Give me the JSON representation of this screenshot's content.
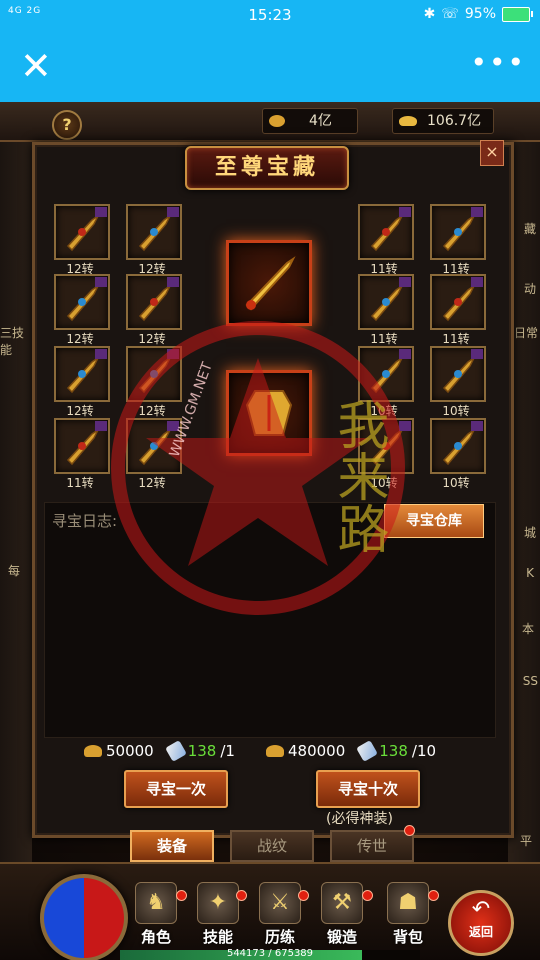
{
  "status_bar": {
    "signal": "4G 2G",
    "time": "15:23",
    "battery": "95%"
  },
  "title_bar": {
    "close_icon": "close-icon",
    "more_icon": "more-icon"
  },
  "resources": {
    "gold": "4亿",
    "ingot": "106.7亿"
  },
  "panel": {
    "title": "至尊宝藏",
    "help": "?",
    "close": "×"
  },
  "left_items": [
    {
      "label": "12转"
    },
    {
      "label": "12转"
    },
    {
      "label": "12转"
    },
    {
      "label": "12转"
    },
    {
      "label": "12转"
    },
    {
      "label": "12转"
    },
    {
      "label": "11转"
    },
    {
      "label": "12转"
    }
  ],
  "right_items": [
    {
      "label": "11转"
    },
    {
      "label": "11转"
    },
    {
      "label": "11转"
    },
    {
      "label": "11转"
    },
    {
      "label": "10转"
    },
    {
      "label": "10转"
    },
    {
      "label": "10转"
    },
    {
      "label": "10转"
    }
  ],
  "log": {
    "label": "寻宝日志:",
    "depot_button": "寻宝仓库"
  },
  "costs": {
    "once_coin": "50000",
    "once_scroll": "138",
    "once_need": "/1",
    "ten_coin": "480000",
    "ten_scroll": "138",
    "ten_need": "/10"
  },
  "buttons": {
    "once": "寻宝一次",
    "ten": "寻宝十次",
    "ten_note": "(必得神装)"
  },
  "tabs": [
    "装备",
    "战纹",
    "传世"
  ],
  "nav": [
    "角色",
    "技能",
    "历练",
    "锻造",
    "背包"
  ],
  "back": "返回",
  "exp": {
    "text": "544173 / 675389",
    "fraction": 0.806
  },
  "side_left": [
    "三技能",
    "每"
  ],
  "side_right": [
    "藏",
    "动",
    "日常",
    "城",
    "K",
    "本",
    "SS",
    "平"
  ],
  "watermark": {
    "url": "WWW.GM.NET",
    "text": "我来路"
  },
  "colors": {
    "accent": "#17b6f4",
    "gold": "#ffd77a",
    "green": "#6adf3a"
  }
}
